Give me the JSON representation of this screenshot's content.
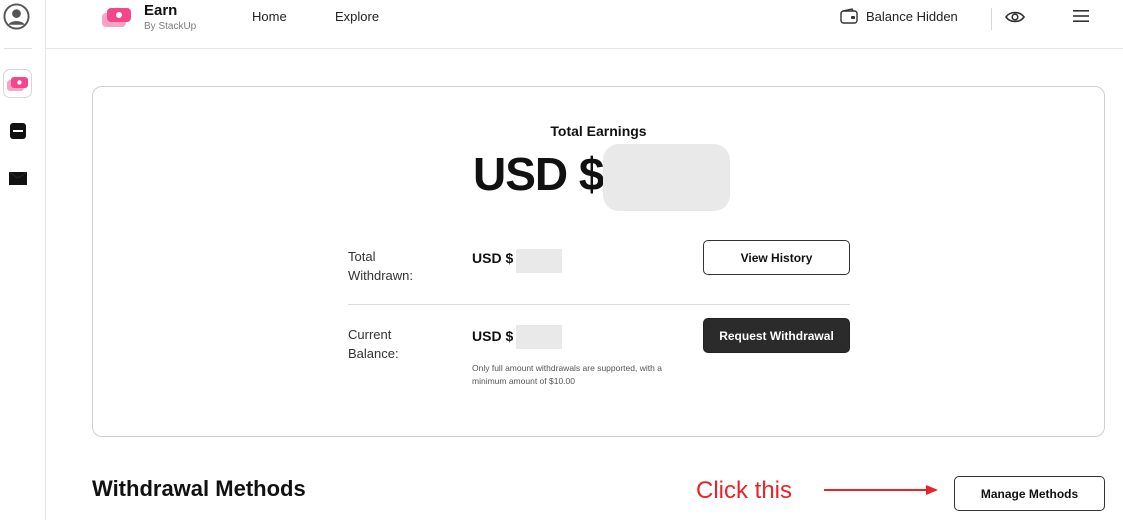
{
  "brand": {
    "title": "Earn",
    "subtitle": "By StackUp"
  },
  "nav": {
    "home": "Home",
    "explore": "Explore"
  },
  "balance_toggle": {
    "label": "Balance Hidden"
  },
  "earnings": {
    "title": "Total Earnings",
    "currency_prefix": "USD $",
    "total_withdrawn_label_line1": "Total",
    "total_withdrawn_label_line2": "Withdrawn:",
    "total_withdrawn_prefix": "USD $",
    "view_history_label": "View History",
    "current_balance_label_line1": "Current",
    "current_balance_label_line2": "Balance:",
    "current_balance_prefix": "USD $",
    "request_withdrawal_label": "Request Withdrawal",
    "note": "Only full amount withdrawals are supported, with a minimum amount of $10.00"
  },
  "withdrawal_methods": {
    "title": "Withdrawal Methods",
    "manage_label": "Manage Methods"
  },
  "annotation": {
    "text": "Click this"
  },
  "colors": {
    "brand_pink": "#f4478b",
    "brand_pink_light": "#f9a3c4",
    "annotation_red": "#e8232a",
    "dark_button": "#2b2b2b",
    "masked_value": "#e9e9e9"
  },
  "icons": {
    "rail": [
      "user-avatar-icon",
      "earn-app-icon",
      "notebook-app-icon",
      "mail-app-icon"
    ],
    "topbar": [
      "earn-logo-icon",
      "wallet-icon",
      "eye-icon",
      "hamburger-menu-icon"
    ]
  }
}
